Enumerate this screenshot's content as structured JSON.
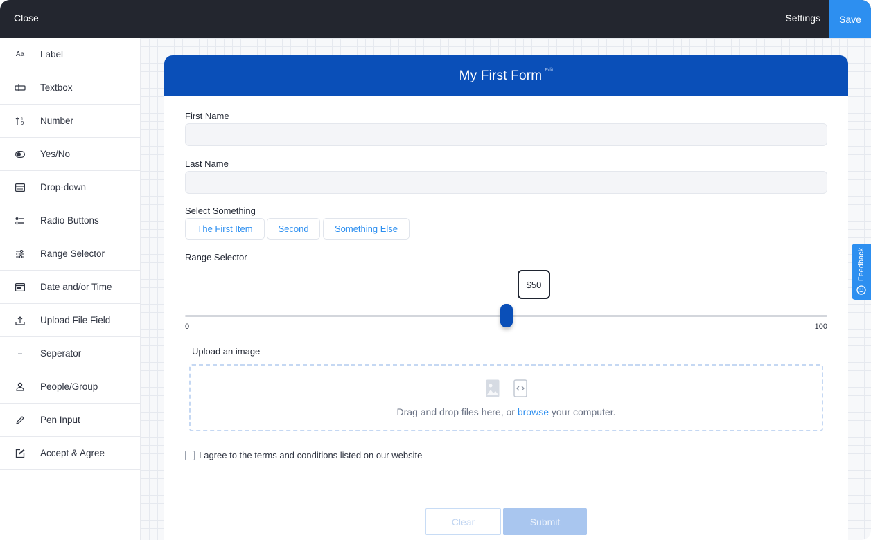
{
  "topbar": {
    "close_label": "Close",
    "settings_label": "Settings",
    "save_label": "Save"
  },
  "sidebar": {
    "items": [
      {
        "label": "Label",
        "icon": "label-icon"
      },
      {
        "label": "Textbox",
        "icon": "textbox-icon"
      },
      {
        "label": "Number",
        "icon": "number-icon"
      },
      {
        "label": "Yes/No",
        "icon": "toggle-icon"
      },
      {
        "label": "Drop-down",
        "icon": "dropdown-icon"
      },
      {
        "label": "Radio Buttons",
        "icon": "radio-list-icon"
      },
      {
        "label": "Range Selector",
        "icon": "sliders-icon"
      },
      {
        "label": "Date and/or Time",
        "icon": "calendar-icon"
      },
      {
        "label": "Upload File Field",
        "icon": "upload-icon"
      },
      {
        "label": "Seperator",
        "icon": "separator-icon"
      },
      {
        "label": "People/Group",
        "icon": "person-icon"
      },
      {
        "label": "Pen Input",
        "icon": "pen-icon"
      },
      {
        "label": "Accept & Agree",
        "icon": "edit-box-icon"
      }
    ]
  },
  "form": {
    "title": "My First Form",
    "edit_label": "Edit",
    "first_name_label": "First Name",
    "last_name_label": "Last Name",
    "select_label": "Select Something",
    "choices": [
      "The First Item",
      "Second",
      "Something Else"
    ],
    "range_label": "Range Selector",
    "range_value_display": "$50",
    "range_value": 50,
    "range_min": "0",
    "range_max": "100",
    "upload_label": "Upload an image",
    "upload_text_before": "Drag and drop files here, or ",
    "upload_browse": "browse",
    "upload_text_after": " your computer.",
    "agree_text": "I agree to the terms and conditions listed on our website",
    "clear_label": "Clear",
    "submit_label": "Submit"
  },
  "feedback_label": "Feedback",
  "colors": {
    "header": "#0a4fb8",
    "accent": "#2d8ff0",
    "topbar": "#23262f"
  }
}
